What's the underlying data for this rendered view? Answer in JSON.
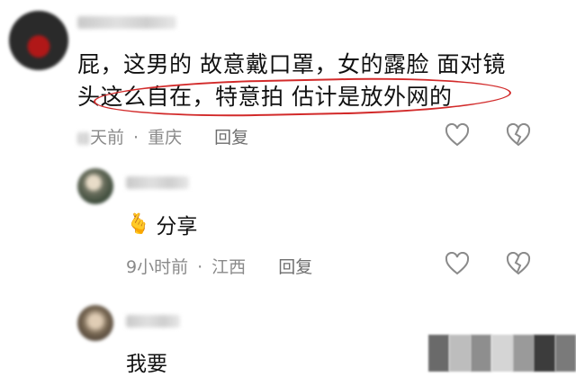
{
  "comment_main": {
    "line1": "屁，这男的 故意戴口罩，女的露脸 面对镜",
    "line2": "头这么自在，特意拍 估计是放外网的",
    "time": "天前",
    "location": "重庆",
    "reply_label": "回复"
  },
  "reply_1": {
    "emoji": "🫰",
    "text": "分享",
    "time": "9小时前",
    "location": "江西",
    "reply_label": "回复"
  },
  "reply_2": {
    "text": "我要"
  },
  "colors": {
    "highlight": "#d22a2a",
    "meta_text": "#8a8a8a"
  }
}
